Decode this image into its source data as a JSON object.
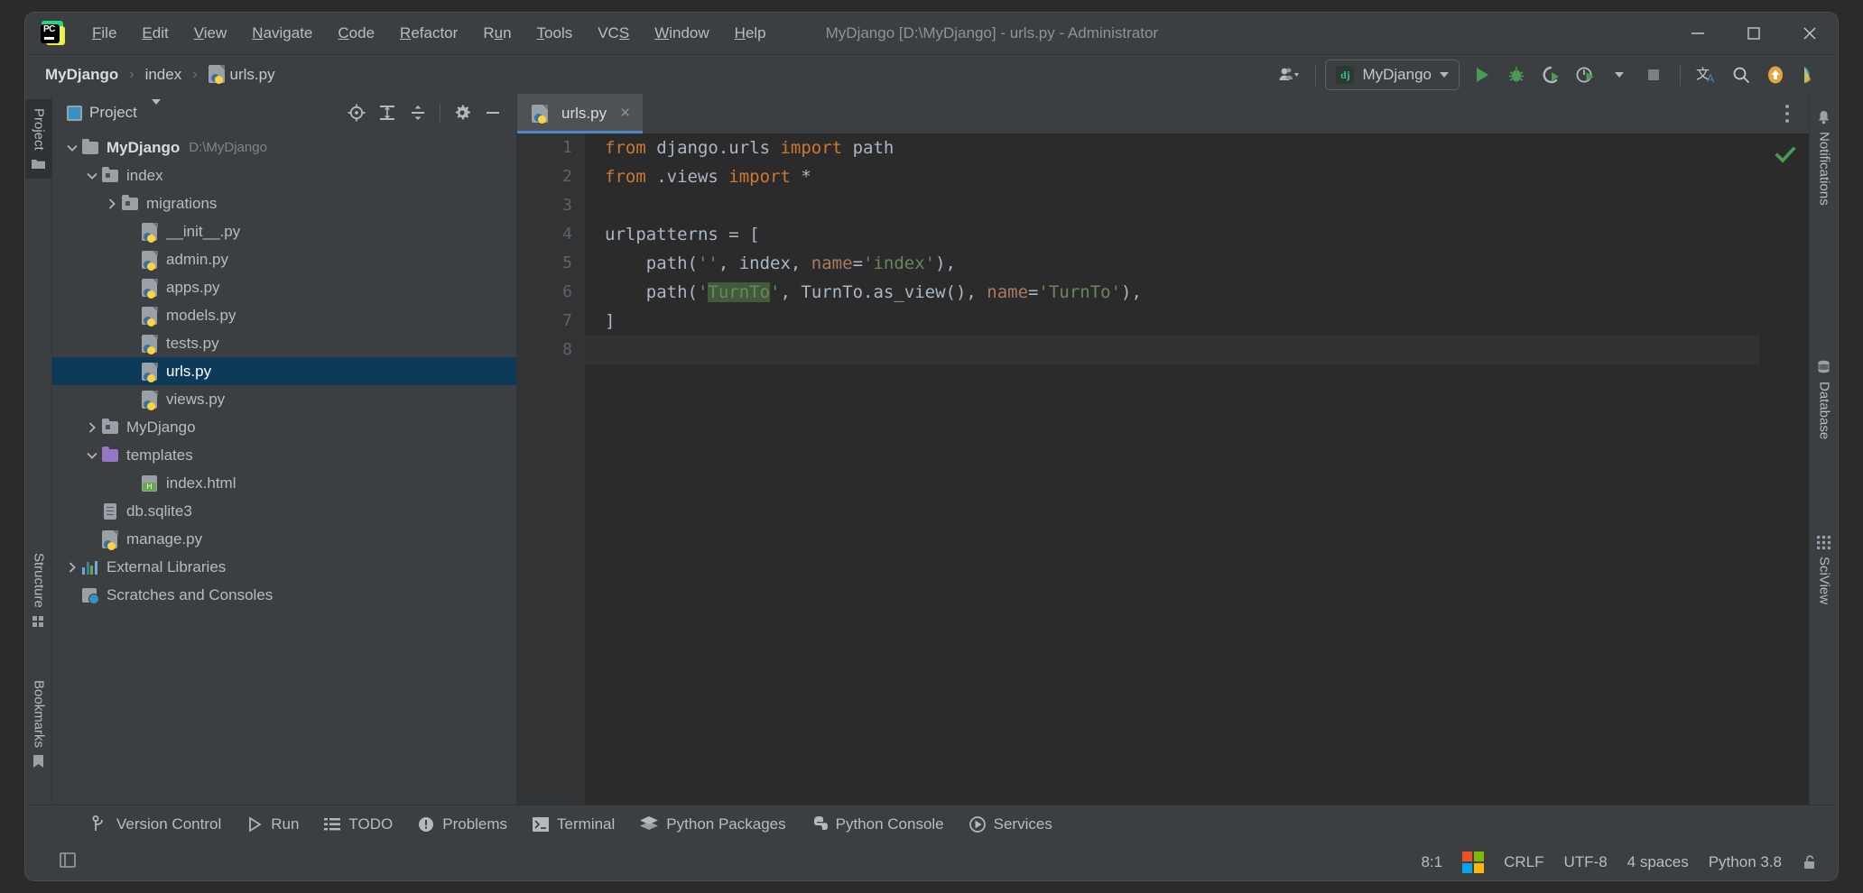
{
  "window": {
    "title": "MyDjango [D:\\MyDjango] - urls.py - Administrator",
    "minimize_label": "minimize-window",
    "maximize_label": "maximize-window",
    "close_label": "close-window"
  },
  "menubar": {
    "items": [
      {
        "label": "File",
        "mnemonic": "F"
      },
      {
        "label": "Edit",
        "mnemonic": "E"
      },
      {
        "label": "View",
        "mnemonic": "V"
      },
      {
        "label": "Navigate",
        "mnemonic": "N"
      },
      {
        "label": "Code",
        "mnemonic": "C"
      },
      {
        "label": "Refactor",
        "mnemonic": "R"
      },
      {
        "label": "Run",
        "mnemonic": "u"
      },
      {
        "label": "Tools",
        "mnemonic": "T"
      },
      {
        "label": "VCS",
        "mnemonic": "S"
      },
      {
        "label": "Window",
        "mnemonic": "W"
      },
      {
        "label": "Help",
        "mnemonic": "H"
      }
    ]
  },
  "breadcrumb": {
    "items": [
      "MyDjango",
      "index",
      "urls.py"
    ],
    "separator": "›"
  },
  "toolbar": {
    "run_config": "MyDjango",
    "icons": [
      "user-accounts-icon",
      "run-icon",
      "debug-icon",
      "run-with-coverage-icon",
      "profile-icon",
      "stop-icon",
      "translate-icon",
      "search-everywhere-icon",
      "update-icon",
      "ai-assistant-icon"
    ]
  },
  "left_rail": {
    "top": [
      {
        "label": "Project",
        "icon": "folder-icon",
        "active": true
      }
    ],
    "bottom": [
      {
        "label": "Structure",
        "icon": "structure-icon"
      },
      {
        "label": "Bookmarks",
        "icon": "bookmark-icon"
      }
    ]
  },
  "right_rail": {
    "items": [
      {
        "label": "Notifications",
        "icon": "bell-icon"
      },
      {
        "label": "Database",
        "icon": "database-icon"
      },
      {
        "label": "SciView",
        "icon": "grid-icon"
      }
    ]
  },
  "project_panel": {
    "title": "Project",
    "tools": [
      "locate-icon",
      "expand-all-icon",
      "collapse-all-icon",
      "settings-gear-icon",
      "hide-icon"
    ],
    "tree": [
      {
        "label": "MyDjango",
        "sub": "D:\\MyDjango",
        "indent": 0,
        "arrow": "down",
        "icon": "folder-icon",
        "bold": true,
        "selected": false
      },
      {
        "label": "index",
        "sub": "",
        "indent": 1,
        "arrow": "down",
        "icon": "module-folder-icon",
        "bold": false,
        "selected": false
      },
      {
        "label": "migrations",
        "sub": "",
        "indent": 2,
        "arrow": "right",
        "icon": "module-folder-icon",
        "bold": false,
        "selected": false
      },
      {
        "label": "__init__.py",
        "sub": "",
        "indent": 3,
        "arrow": "none",
        "icon": "python-file-icon",
        "bold": false,
        "selected": false
      },
      {
        "label": "admin.py",
        "sub": "",
        "indent": 3,
        "arrow": "none",
        "icon": "python-file-icon",
        "bold": false,
        "selected": false
      },
      {
        "label": "apps.py",
        "sub": "",
        "indent": 3,
        "arrow": "none",
        "icon": "python-file-icon",
        "bold": false,
        "selected": false
      },
      {
        "label": "models.py",
        "sub": "",
        "indent": 3,
        "arrow": "none",
        "icon": "python-file-icon",
        "bold": false,
        "selected": false
      },
      {
        "label": "tests.py",
        "sub": "",
        "indent": 3,
        "arrow": "none",
        "icon": "python-file-icon",
        "bold": false,
        "selected": false
      },
      {
        "label": "urls.py",
        "sub": "",
        "indent": 3,
        "arrow": "none",
        "icon": "python-file-icon",
        "bold": false,
        "selected": true
      },
      {
        "label": "views.py",
        "sub": "",
        "indent": 3,
        "arrow": "none",
        "icon": "python-file-icon",
        "bold": false,
        "selected": false
      },
      {
        "label": "MyDjango",
        "sub": "",
        "indent": 1,
        "arrow": "right",
        "icon": "module-folder-icon",
        "bold": false,
        "selected": false
      },
      {
        "label": "templates",
        "sub": "",
        "indent": 1,
        "arrow": "down",
        "icon": "templates-folder-icon",
        "bold": false,
        "selected": false
      },
      {
        "label": "index.html",
        "sub": "",
        "indent": 3,
        "arrow": "none",
        "icon": "html-file-icon",
        "bold": false,
        "selected": false
      },
      {
        "label": "db.sqlite3",
        "sub": "",
        "indent": 1,
        "arrow": "none",
        "icon": "db-file-icon",
        "bold": false,
        "selected": false
      },
      {
        "label": "manage.py",
        "sub": "",
        "indent": 1,
        "arrow": "none",
        "icon": "python-file-icon",
        "bold": false,
        "selected": false
      },
      {
        "label": "External Libraries",
        "sub": "",
        "indent": 0,
        "arrow": "right",
        "icon": "libraries-icon",
        "bold": false,
        "selected": false
      },
      {
        "label": "Scratches and Consoles",
        "sub": "",
        "indent": 0,
        "arrow": "none",
        "icon": "scratches-icon",
        "bold": false,
        "selected": false
      }
    ]
  },
  "editor": {
    "tabs": [
      {
        "label": "urls.py",
        "icon": "python-file-icon",
        "active": true,
        "close": "×"
      }
    ],
    "inspection_status": "ok",
    "lines": [
      {
        "n": "1",
        "fold": "start",
        "current": false,
        "tokens": [
          {
            "t": "from",
            "c": "kw"
          },
          {
            "t": " django.urls ",
            "c": "def"
          },
          {
            "t": "import",
            "c": "kw"
          },
          {
            "t": " path",
            "c": "def"
          }
        ]
      },
      {
        "n": "2",
        "fold": "end",
        "current": false,
        "tokens": [
          {
            "t": "from",
            "c": "kw"
          },
          {
            "t": " .views ",
            "c": "def"
          },
          {
            "t": "import",
            "c": "kw"
          },
          {
            "t": " *",
            "c": "def"
          }
        ]
      },
      {
        "n": "3",
        "fold": "none",
        "current": false,
        "tokens": [
          {
            "t": "",
            "c": "def"
          }
        ]
      },
      {
        "n": "4",
        "fold": "start",
        "current": false,
        "tokens": [
          {
            "t": "urlpatterns = [",
            "c": "def"
          }
        ]
      },
      {
        "n": "5",
        "fold": "none",
        "current": false,
        "tokens": [
          {
            "t": "    path(",
            "c": "def"
          },
          {
            "t": "''",
            "c": "str"
          },
          {
            "t": ", index, ",
            "c": "def"
          },
          {
            "t": "name",
            "c": "kwarg"
          },
          {
            "t": "=",
            "c": "def"
          },
          {
            "t": "'index'",
            "c": "str"
          },
          {
            "t": "),",
            "c": "def"
          }
        ]
      },
      {
        "n": "6",
        "fold": "none",
        "current": false,
        "tokens": [
          {
            "t": "    path(",
            "c": "def"
          },
          {
            "t": "'",
            "c": "str"
          },
          {
            "t": "TurnTo",
            "c": "str hl"
          },
          {
            "t": "'",
            "c": "str"
          },
          {
            "t": ", TurnTo.as_view(), ",
            "c": "def"
          },
          {
            "t": "name",
            "c": "kwarg"
          },
          {
            "t": "=",
            "c": "def"
          },
          {
            "t": "'TurnTo'",
            "c": "str"
          },
          {
            "t": "),",
            "c": "def"
          }
        ]
      },
      {
        "n": "7",
        "fold": "end",
        "current": false,
        "tokens": [
          {
            "t": "]",
            "c": "def"
          }
        ]
      },
      {
        "n": "8",
        "fold": "none",
        "current": true,
        "tokens": [
          {
            "t": "",
            "c": "def"
          }
        ]
      }
    ]
  },
  "bottom_bar": {
    "items": [
      {
        "label": "Version Control",
        "icon": "branch-icon"
      },
      {
        "label": "Run",
        "icon": "run-icon"
      },
      {
        "label": "TODO",
        "icon": "list-icon"
      },
      {
        "label": "Problems",
        "icon": "warning-icon"
      },
      {
        "label": "Terminal",
        "icon": "terminal-icon"
      },
      {
        "label": "Python Packages",
        "icon": "packages-icon"
      },
      {
        "label": "Python Console",
        "icon": "python-icon"
      },
      {
        "label": "Services",
        "icon": "services-icon"
      }
    ]
  },
  "status_bar": {
    "left_icon": "layout-icon",
    "caret_position": "8:1",
    "os_icon": "windows-logo-icon",
    "line_separator": "CRLF",
    "encoding": "UTF-8",
    "indent": "4 spaces",
    "interpreter": "Python 3.8",
    "lock": "unlocked-icon"
  },
  "colors": {
    "accent_blue": "#4a88c7",
    "selection_blue": "#0d3a58",
    "keyword_orange": "#cc7832",
    "string_green": "#6a8759",
    "highlight_green": "#43593b",
    "default_text": "#a9b7c6",
    "panel_bg": "#3c3f41",
    "editor_bg": "#2b2b2b",
    "gutter_bg": "#313335",
    "django_green": "#44b78b",
    "ok_green": "#499c54"
  }
}
